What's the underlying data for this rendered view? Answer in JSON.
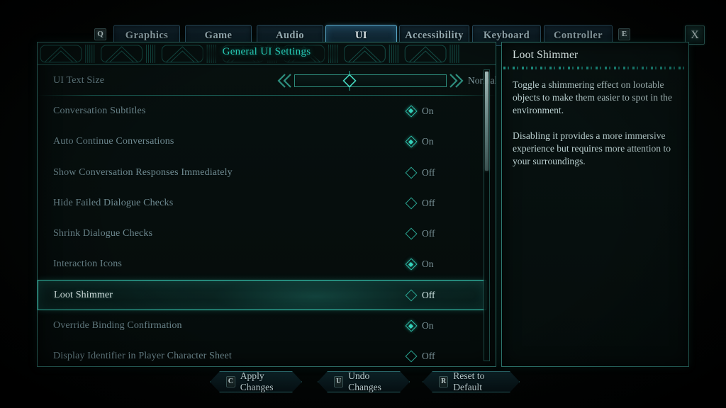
{
  "tabs": {
    "prev_key": "Q",
    "next_key": "E",
    "close_label": "X",
    "items": [
      {
        "label": "Graphics",
        "id": "graphics",
        "active": false
      },
      {
        "label": "Game",
        "id": "game",
        "active": false
      },
      {
        "label": "Audio",
        "id": "audio",
        "active": false
      },
      {
        "label": "UI",
        "id": "ui",
        "active": true
      },
      {
        "label": "Accessibility",
        "id": "accessibility",
        "active": false
      },
      {
        "label": "Keyboard",
        "id": "keyboard",
        "active": false
      },
      {
        "label": "Controller",
        "id": "controller",
        "active": false
      }
    ]
  },
  "panel": {
    "title": "General UI Settings",
    "rows": [
      {
        "label": "UI Text Size",
        "type": "slider",
        "value": "Normal",
        "handle_pct": 30,
        "selected": false,
        "divider": true
      },
      {
        "label": "Conversation Subtitles",
        "type": "toggle",
        "value": "On",
        "selected": false,
        "divider": false
      },
      {
        "label": "Auto Continue Conversations",
        "type": "toggle",
        "value": "On",
        "selected": false,
        "divider": false
      },
      {
        "label": "Show Conversation Responses Immediately",
        "type": "toggle",
        "value": "Off",
        "selected": false,
        "divider": false
      },
      {
        "label": "Hide Failed Dialogue Checks",
        "type": "toggle",
        "value": "Off",
        "selected": false,
        "divider": false
      },
      {
        "label": "Shrink Dialogue Checks",
        "type": "toggle",
        "value": "Off",
        "selected": false,
        "divider": false
      },
      {
        "label": "Interaction Icons",
        "type": "toggle",
        "value": "On",
        "selected": false,
        "divider": false
      },
      {
        "label": "Loot Shimmer",
        "type": "toggle",
        "value": "Off",
        "selected": true,
        "divider": false
      },
      {
        "label": "Override Binding Confirmation",
        "type": "toggle",
        "value": "On",
        "selected": false,
        "divider": false
      },
      {
        "label": "Display Identifier in Player Character Sheet",
        "type": "toggle",
        "value": "Off",
        "selected": false,
        "divider": false
      }
    ]
  },
  "tooltip": {
    "title": "Loot Shimmer",
    "paragraph1": "Toggle a shimmering effect on lootable objects to make them easier to spot in the environment.",
    "paragraph2": "Disabling it provides a more immersive experience but requires more attention to your surroundings."
  },
  "footer": {
    "actions": [
      {
        "key": "C",
        "label": "Apply Changes",
        "id": "apply"
      },
      {
        "key": "U",
        "label": "Undo Changes",
        "id": "undo"
      },
      {
        "key": "R",
        "label": "Reset to Default",
        "id": "reset"
      }
    ]
  },
  "colors": {
    "accent_teal": "#2fc4ae",
    "selected_border": "#3ee0c8",
    "active_tab_border": "#63b6d8",
    "title_teal": "#27c9b4",
    "label_muted": "#6f8b92"
  }
}
